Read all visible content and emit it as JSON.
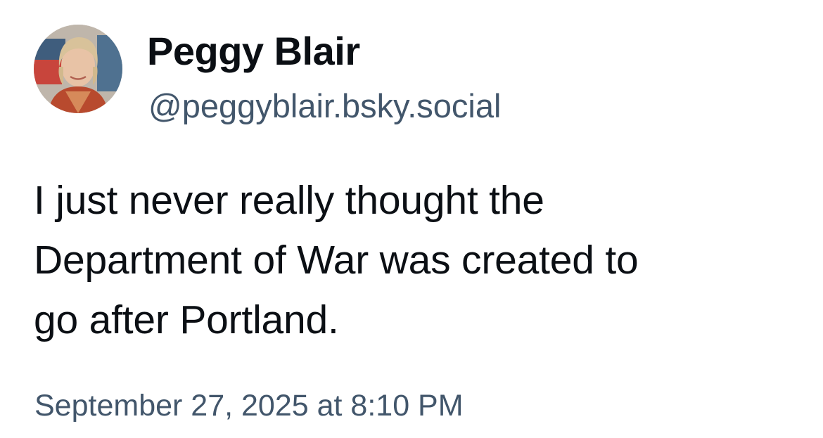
{
  "author": {
    "display_name": "Peggy Blair",
    "handle": "@peggyblair.bsky.social"
  },
  "post": {
    "text_lines": [
      "I just never really thought the",
      "Department of War was created to",
      "go after Portland."
    ],
    "timestamp": "September 27, 2025 at 8:10 PM"
  },
  "colors": {
    "background": "#ffffff",
    "primary_text": "#0b0f14",
    "secondary_text": "#42566b"
  }
}
